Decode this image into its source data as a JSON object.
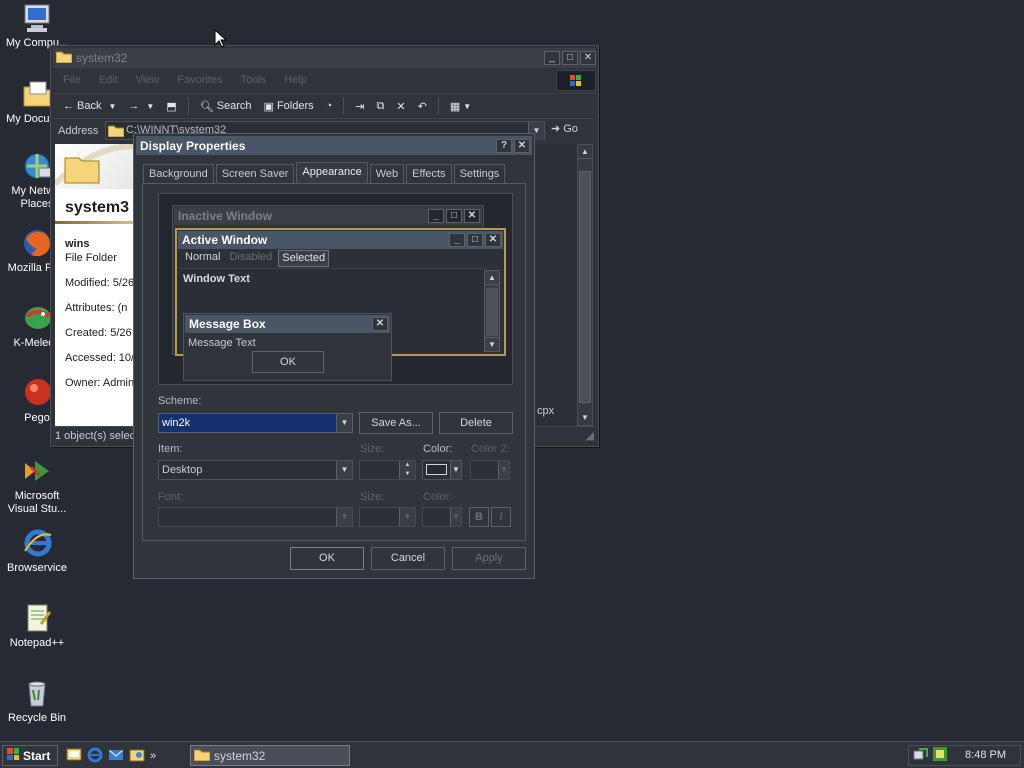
{
  "desktop": {
    "icons": [
      {
        "label": "My Compu...",
        "icon": "computer-icon"
      },
      {
        "label": "My Docum...",
        "icon": "folder-icon"
      },
      {
        "label": "My Netw... Places",
        "icon": "network-icon"
      },
      {
        "label": "Mozilla Fir...",
        "icon": "firefox-icon"
      },
      {
        "label": "K-Meleon",
        "icon": "kmeleon-icon"
      },
      {
        "label": "Pego",
        "icon": "pego-icon"
      },
      {
        "label": "Microsoft Visual Stu...",
        "icon": "visual-studio-icon"
      },
      {
        "label": "Browservice",
        "icon": "ie-icon"
      },
      {
        "label": "Notepad++",
        "icon": "notepadpp-icon"
      },
      {
        "label": "Recycle Bin",
        "icon": "recycle-bin-icon"
      }
    ]
  },
  "explorer": {
    "title": "system32",
    "menu": [
      "File",
      "Edit",
      "View",
      "Favorites",
      "Tools",
      "Help"
    ],
    "toolbar": {
      "back": "Back",
      "search": "Search",
      "folders": "Folders"
    },
    "address_label": "Address",
    "address_value": "C:\\WINNT\\system32",
    "go_label": "Go",
    "folder_heading": "system3",
    "item_name": "wins",
    "item_type": "File Folder",
    "details": {
      "modified": "Modified: 5/26",
      "attributes": "Attributes: (n",
      "created": "Created: 5/26",
      "accessed": "Accessed: 10/",
      "owner": "Owner: Admin"
    },
    "right_fragment": "cpx",
    "status": "1 object(s) selec"
  },
  "display_properties": {
    "title": "Display Properties",
    "tabs": [
      "Background",
      "Screen Saver",
      "Appearance",
      "Web",
      "Effects",
      "Settings"
    ],
    "selected_tab": "Appearance",
    "preview": {
      "inactive_title": "Inactive Window",
      "active_title": "Active Window",
      "menu_normal": "Normal",
      "menu_disabled": "Disabled",
      "menu_selected": "Selected",
      "window_text": "Window Text",
      "msgbox_title": "Message Box",
      "msgbox_text": "Message Text",
      "msgbox_ok": "OK"
    },
    "scheme_label": "Scheme:",
    "scheme_value": "win2k",
    "save_as": "Save As...",
    "delete": "Delete",
    "item_label": "Item:",
    "item_value": "Desktop",
    "size_label": "Size:",
    "color_label": "Color:",
    "color2_label": "Color 2:",
    "font_label": "Font:",
    "font_size_label": "Size:",
    "font_color_label": "Color:",
    "bold_label": "B",
    "italic_label": "I",
    "ok": "OK",
    "cancel": "Cancel",
    "apply": "Apply"
  },
  "taskbar": {
    "start": "Start",
    "task_label": "system32",
    "clock": "8:48 PM"
  },
  "colors": {
    "desktop_bg": "#262a32",
    "active_title": "#4a5566",
    "scheme_selection": "#15306e",
    "active_border": "#b89a4a"
  }
}
